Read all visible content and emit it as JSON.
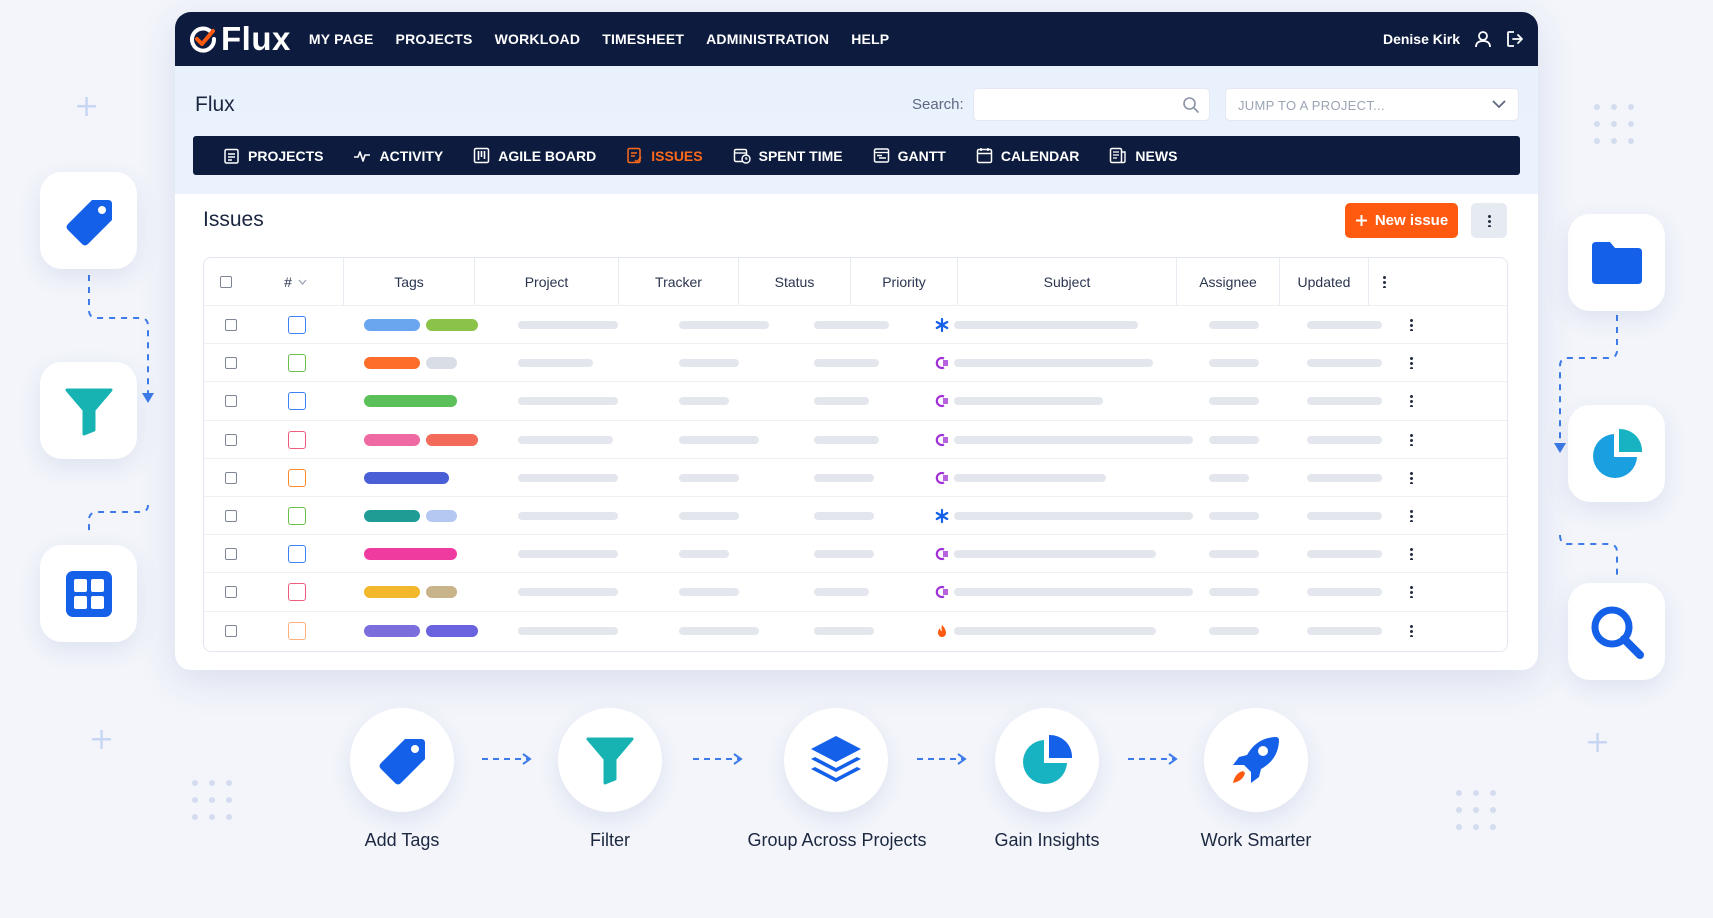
{
  "app": {
    "name": "Flux"
  },
  "topnav": {
    "items": [
      "MY PAGE",
      "PROJECTS",
      "WORKLOAD",
      "TIMESHEET",
      "ADMINISTRATION",
      "HELP"
    ],
    "user": "Denise Kirk"
  },
  "project": {
    "title": "Flux",
    "search_label": "Search:",
    "search_value": "",
    "jump_placeholder": "JUMP TO A PROJECT..."
  },
  "subnav": {
    "items": [
      {
        "label": "PROJECTS",
        "icon": "clipboard-icon",
        "active": false
      },
      {
        "label": "ACTIVITY",
        "icon": "activity-icon",
        "active": false
      },
      {
        "label": "AGILE BOARD",
        "icon": "board-icon",
        "active": false
      },
      {
        "label": "ISSUES",
        "icon": "issues-icon",
        "active": true
      },
      {
        "label": "SPENT TIME",
        "icon": "clock-calendar-icon",
        "active": false
      },
      {
        "label": "GANTT",
        "icon": "gantt-icon",
        "active": false
      },
      {
        "label": "CALENDAR",
        "icon": "calendar-icon",
        "active": false
      },
      {
        "label": "NEWS",
        "icon": "news-icon",
        "active": false
      }
    ]
  },
  "issues": {
    "title": "Issues",
    "new_issue_label": "New issue",
    "columns": [
      "#",
      "Tags",
      "Project",
      "Tracker",
      "Status",
      "Priority",
      "Subject",
      "Assignee",
      "Updated"
    ],
    "rows": [
      {
        "tracker_color": "#3b82f6",
        "tags": [
          "#6aa6f0",
          "#8bc34a"
        ],
        "priority": "normal"
      },
      {
        "tracker_color": "#6cc04a",
        "tags": [
          "#ff6d2a",
          "#d9dde5"
        ],
        "priority": "high"
      },
      {
        "tracker_color": "#3b82f6",
        "tags": [
          "#5cc05a"
        ],
        "priority": "high"
      },
      {
        "tracker_color": "#f05a7e",
        "tags": [
          "#ef6aa2",
          "#f26b5b"
        ],
        "priority": "high"
      },
      {
        "tracker_color": "#ff8a2a",
        "tags": [
          "#4a5fd6"
        ],
        "priority": "high"
      },
      {
        "tracker_color": "#6cc04a",
        "tags": [
          "#1f9c94",
          "#b5c8f2"
        ],
        "priority": "normal"
      },
      {
        "tracker_color": "#3b82f6",
        "tags": [
          "#ef3ba0"
        ],
        "priority": "high"
      },
      {
        "tracker_color": "#f05a7e",
        "tags": [
          "#f2b72a",
          "#c9b38a"
        ],
        "priority": "high"
      },
      {
        "tracker_color": "#ffb07a",
        "tags": [
          "#7b6ddb",
          "#6b62e0"
        ],
        "priority": "urgent"
      }
    ]
  },
  "flow": {
    "steps": [
      "Add Tags",
      "Filter",
      "Group Across Projects",
      "Gain Insights",
      "Work Smarter"
    ]
  },
  "colors": {
    "navy": "#0d1b3e",
    "accent": "#ff5a0f",
    "blue": "#1560e8",
    "teal": "#17b3c3"
  }
}
